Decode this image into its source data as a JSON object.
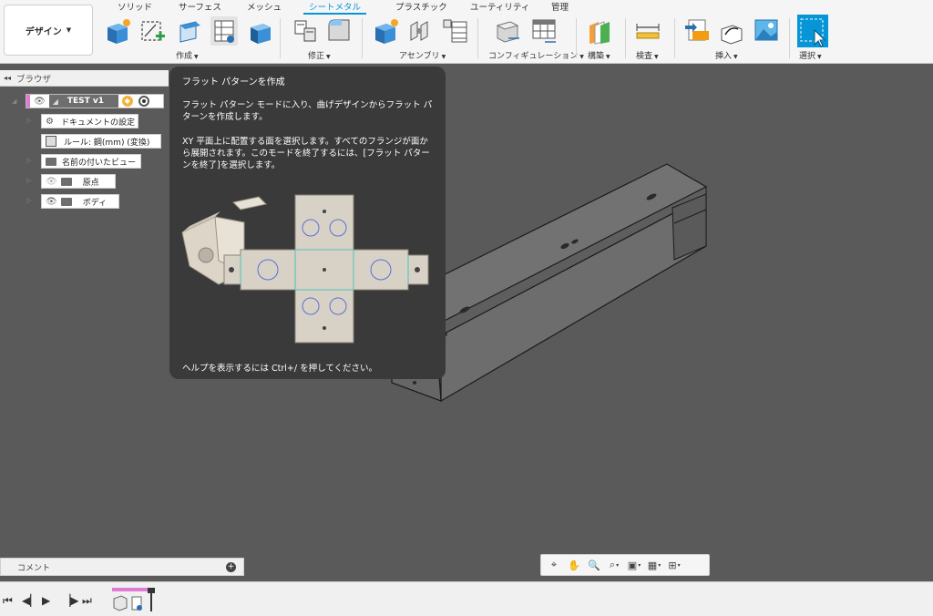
{
  "toolbar": {
    "workspace_label": "デザイン",
    "tabs": [
      "ソリッド",
      "サーフェス",
      "メッシュ",
      "シートメタル",
      "プラスチック",
      "ユーティリティ",
      "管理"
    ],
    "active_tab": "シートメタル",
    "groups": [
      "作成",
      "修正",
      "アセンブリ",
      "コンフィギュレーション",
      "構築",
      "検査",
      "挿入",
      "選択"
    ]
  },
  "browser": {
    "title": "ブラウザ",
    "root": "TEST v1",
    "items": [
      "ドキュメントの設定",
      "ルール: 鋼(mm) (変換)",
      "名前の付いたビュー",
      "原点",
      "ボディ"
    ]
  },
  "tooltip": {
    "title": "フラット パターンを作成",
    "desc1": "フラット パターン モードに入り、曲げデザインからフラット パターンを作成します。",
    "desc2": "XY 平面上に配置する面を選択します。すべてのフランジが面から展開されます。このモードを終了するには、[フラット パターンを終了]を選択します。",
    "help": "ヘルプを表示するには Ctrl+/ を押してください。"
  },
  "comment": {
    "label": "コメント"
  },
  "colors": {
    "accent": "#0696d7",
    "tooltip_bg": "#3a3a3a",
    "viewport_bg": "#5a5a5a",
    "model_face": "#727272"
  }
}
